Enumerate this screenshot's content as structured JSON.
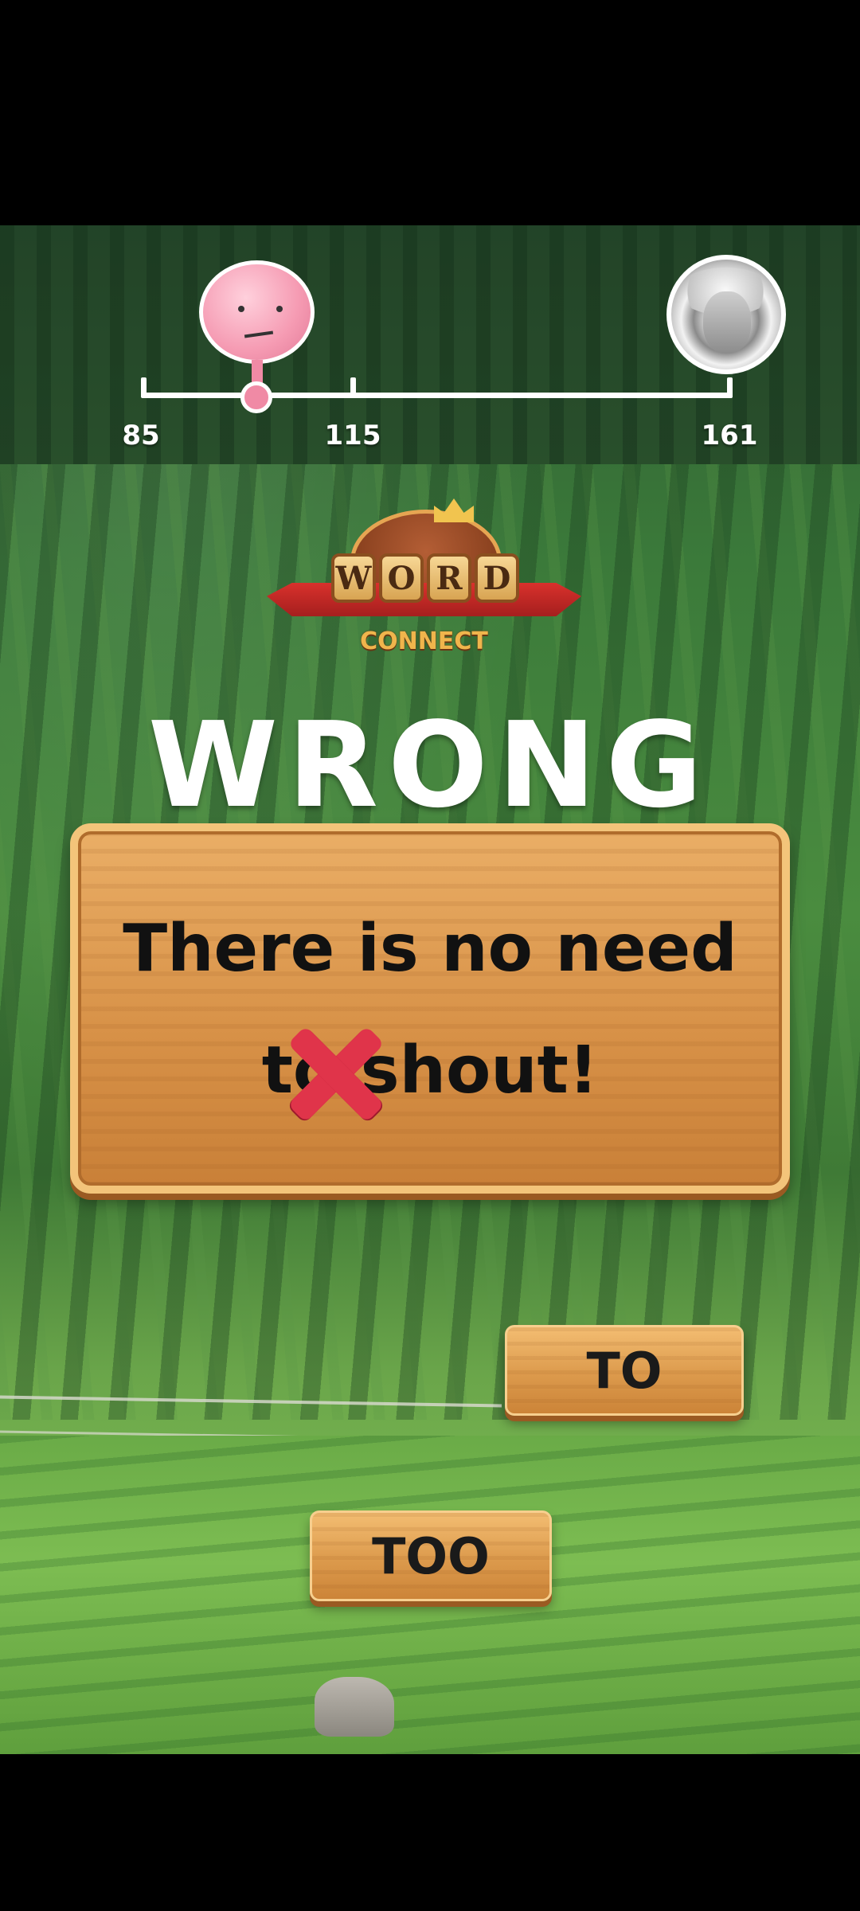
{
  "progress": {
    "scores": [
      "85",
      "115",
      "161"
    ],
    "markers": [
      "brain-avatar",
      "einstein-avatar"
    ]
  },
  "logo": {
    "letters": [
      "W",
      "O",
      "R",
      "D"
    ],
    "subtitle": "CONNECT"
  },
  "status": {
    "title": "WRONG"
  },
  "message": {
    "line1": "There is no need",
    "line2": "to shout!"
  },
  "answers": [
    "TO",
    "TOO"
  ],
  "colors": {
    "wrong_mark": "#e0344a",
    "board": "#d89248",
    "ribbon": "#d9312c"
  }
}
